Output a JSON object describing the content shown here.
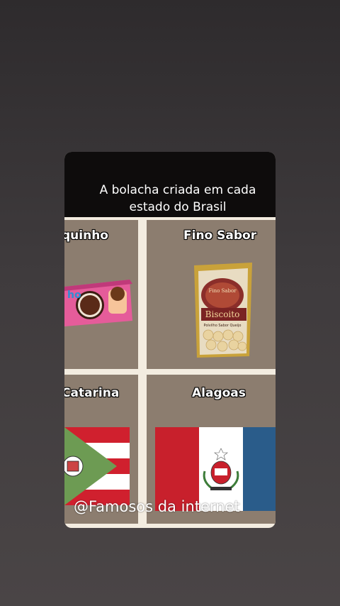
{
  "card": {
    "title_line1": "A bolacha criada em cada",
    "title_line2": "estado do Brasil"
  },
  "cells": {
    "top_left": {
      "label": "quinho",
      "image": "cookie-package"
    },
    "top_right": {
      "label": "Fino Sabor",
      "image": "biscuit-bag"
    },
    "bottom_left": {
      "label": "Catarina",
      "image": "santa-catarina-flag"
    },
    "bottom_right": {
      "label": "Alagoas",
      "image": "alagoas-flag"
    }
  },
  "biscuit_bag": {
    "brand": "Fino Sabor",
    "line1": "Biscoito",
    "line2": "Polvilho Sabor Queijo"
  },
  "cookie_package": {
    "text": "ho"
  },
  "watermark": "@Famosos da internet",
  "colors": {
    "header_bg": "#0e0c0c",
    "cell_bg": "#8c7d6f",
    "card_border": "#f3ece0"
  }
}
